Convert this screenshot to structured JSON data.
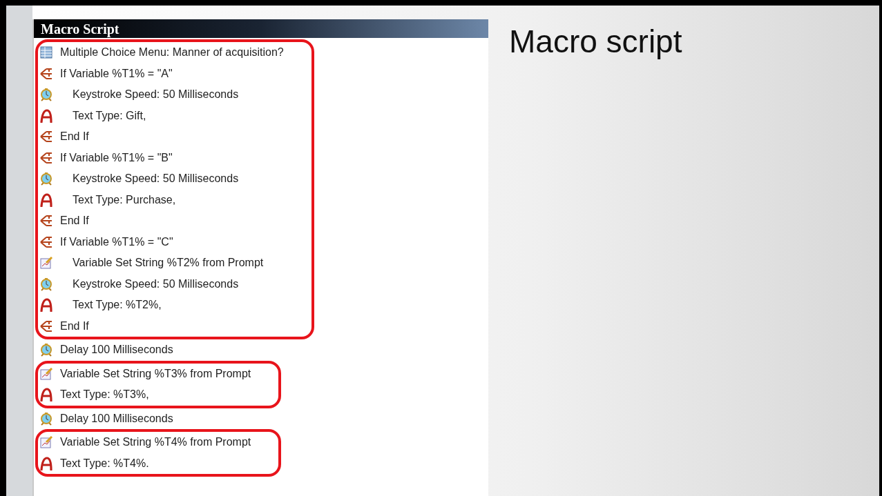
{
  "panel": {
    "title": "Macro Script",
    "groups": [
      {
        "highlighted": true,
        "steps": [
          {
            "kind": "menu",
            "text": "Multiple Choice Menu: Manner of acquisition?"
          },
          {
            "kind": "branch",
            "text": "If Variable %T1% = \"A\"",
            "children": [
              {
                "kind": "speed",
                "text": "Keystroke Speed: 50 Milliseconds"
              },
              {
                "kind": "type",
                "text": "Text Type: Gift,"
              }
            ]
          },
          {
            "kind": "branch",
            "text": "End If"
          },
          {
            "kind": "branch",
            "text": "If Variable %T1% = \"B\"",
            "children": [
              {
                "kind": "speed",
                "text": "Keystroke Speed: 50 Milliseconds"
              },
              {
                "kind": "type",
                "text": "Text Type: Purchase,"
              }
            ]
          },
          {
            "kind": "branch",
            "text": "End If"
          },
          {
            "kind": "branch",
            "text": "If Variable %T1% = \"C\"",
            "children": [
              {
                "kind": "prompt",
                "text": "Variable Set String %T2% from Prompt"
              },
              {
                "kind": "speed",
                "text": "Keystroke Speed: 50 Milliseconds"
              },
              {
                "kind": "type",
                "text": "Text Type: %T2%,"
              }
            ]
          },
          {
            "kind": "branch",
            "text": "End If"
          }
        ]
      },
      {
        "highlighted": false,
        "steps": [
          {
            "kind": "speed",
            "text": "Delay 100 Milliseconds"
          }
        ]
      },
      {
        "highlighted": true,
        "steps": [
          {
            "kind": "prompt",
            "text": "Variable Set String %T3% from Prompt"
          },
          {
            "kind": "type",
            "text": "Text Type: %T3%,"
          }
        ]
      },
      {
        "highlighted": false,
        "steps": [
          {
            "kind": "speed",
            "text": "Delay 100 Milliseconds"
          }
        ]
      },
      {
        "highlighted": true,
        "steps": [
          {
            "kind": "prompt",
            "text": "Variable Set String %T4% from Prompt"
          },
          {
            "kind": "type",
            "text": "Text Type: %T4%."
          }
        ]
      }
    ]
  },
  "slide_title": "Macro script"
}
